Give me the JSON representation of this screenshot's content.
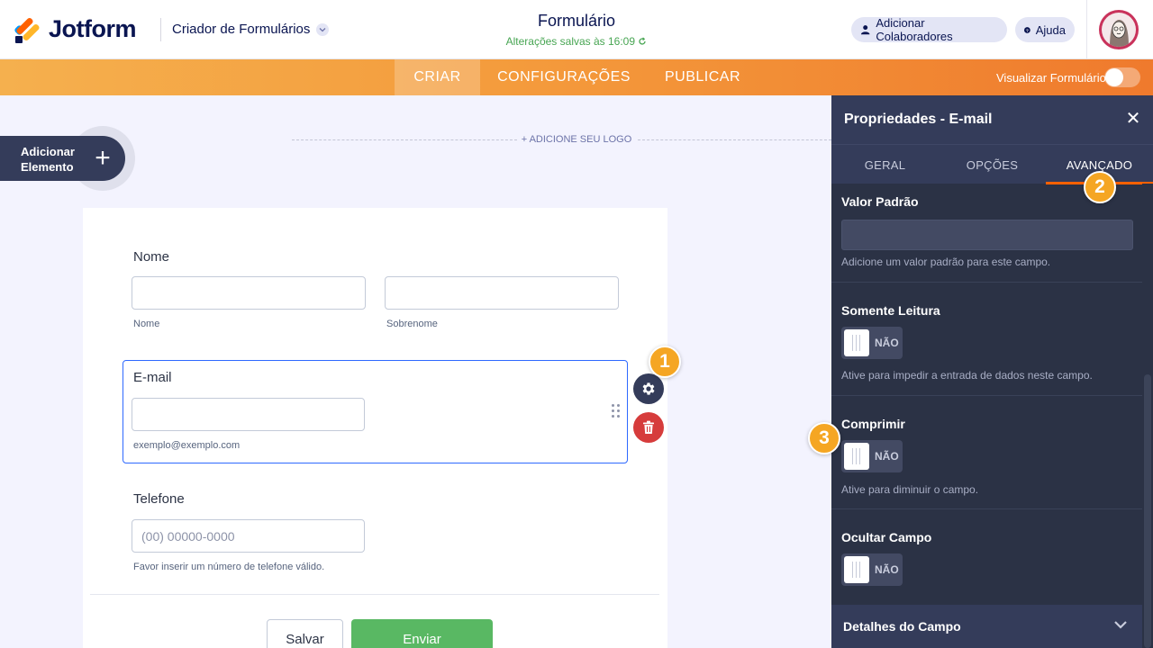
{
  "header": {
    "brand": "Jotform",
    "builder_menu": "Criador de Formulários",
    "form_title": "Formulário",
    "save_status": "Alterações salvas às 16:09",
    "collaborators_button": "Adicionar Colaboradores",
    "help_button": "Ajuda"
  },
  "nav": {
    "tabs": [
      "CRIAR",
      "CONFIGURAÇÕES",
      "PUBLICAR"
    ],
    "active_tab": "CRIAR",
    "preview_label": "Visualizar Formulário",
    "preview_enabled": false
  },
  "canvas": {
    "add_element_line1": "Adicionar",
    "add_element_line2": "Elemento",
    "add_logo": "+ ADICIONE SEU LOGO"
  },
  "form": {
    "name": {
      "label": "Nome",
      "first_sublabel": "Nome",
      "last_sublabel": "Sobrenome"
    },
    "email": {
      "label": "E-mail",
      "sublabel": "exemplo@exemplo.com"
    },
    "phone": {
      "label": "Telefone",
      "placeholder": "(00) 00000-0000",
      "sublabel": "Favor inserir um número de telefone válido."
    },
    "save_button": "Salvar",
    "submit_button": "Enviar"
  },
  "badges": [
    "1",
    "2",
    "3"
  ],
  "panel": {
    "title": "Propriedades - E-mail",
    "tabs": [
      "GERAL",
      "OPÇÕES",
      "AVANÇADO"
    ],
    "active_tab": "AVANÇADO",
    "default_value": {
      "title": "Valor Padrão",
      "value": "",
      "description": "Adicione um valor padrão para este campo."
    },
    "read_only": {
      "title": "Somente Leitura",
      "state": "NÃO",
      "description": "Ative para impedir a entrada de dados neste campo."
    },
    "shrink": {
      "title": "Comprimir",
      "state": "NÃO",
      "description": "Ative para diminuir o campo."
    },
    "hide_field": {
      "title": "Ocultar Campo",
      "state": "NÃO"
    },
    "field_details": "Detalhes do Campo"
  },
  "colors": {
    "accent_orange": "#ff6100",
    "badge": "#f5a623",
    "submit_green": "#59b863",
    "delete_red": "#d63c3c",
    "panel_bg": "#2b3245",
    "selection_blue": "#2e69ff"
  }
}
